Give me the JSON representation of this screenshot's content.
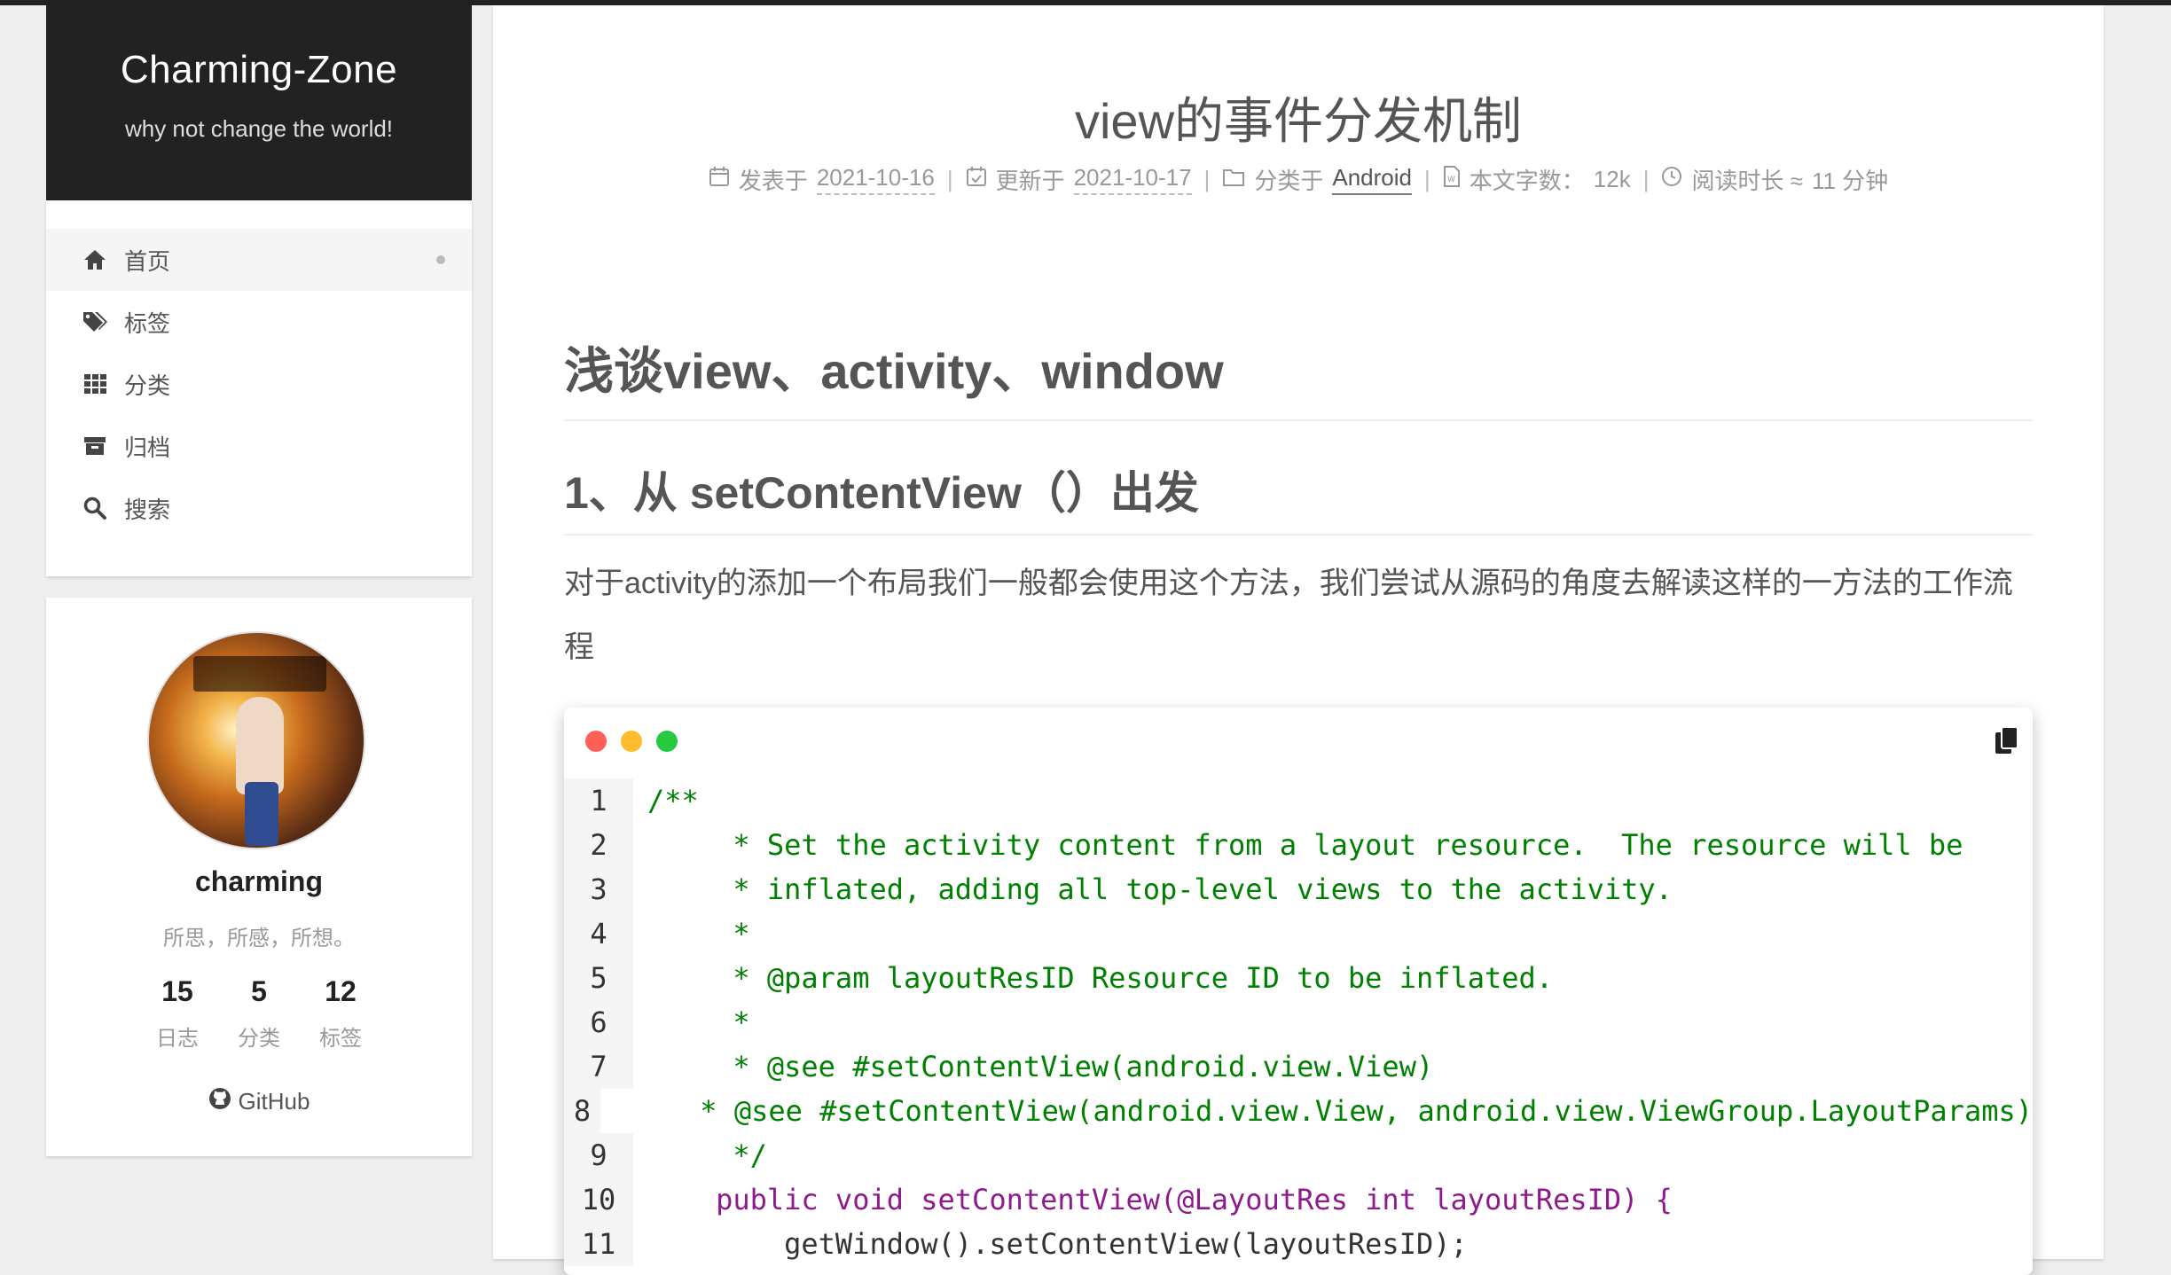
{
  "site": {
    "title": "Charming-Zone",
    "subtitle": "why not change the world!"
  },
  "menu": {
    "items": [
      {
        "label": "首页",
        "icon": "home-icon",
        "active": true
      },
      {
        "label": "标签",
        "icon": "tags-icon"
      },
      {
        "label": "分类",
        "icon": "grid-icon"
      },
      {
        "label": "归档",
        "icon": "archive-icon"
      },
      {
        "label": "搜索",
        "icon": "search-icon"
      }
    ]
  },
  "profile": {
    "name": "charming",
    "description": "所思，所感，所想。",
    "stats": [
      {
        "num": "15",
        "label": "日志"
      },
      {
        "num": "5",
        "label": "分类"
      },
      {
        "num": "12",
        "label": "标签"
      }
    ],
    "github": "GitHub"
  },
  "post": {
    "title": "view的事件分发机制",
    "meta": {
      "posted_label": "发表于",
      "posted_date": "2021-10-16",
      "updated_label": "更新于",
      "updated_date": "2021-10-17",
      "category_label": "分类于",
      "category": "Android",
      "words_label": "本文字数：",
      "words": "12k",
      "read_label": "阅读时长 ≈",
      "read_time": "11 分钟"
    },
    "heading1": "浅谈view、activity、window",
    "heading2": "1、从 setContentView（）出发",
    "paragraph": "对于activity的添加一个布局我们一般都会使用这个方法，我们尝试从源码的角度去解读这样的一方法的工作流程"
  },
  "code": {
    "window_colors": [
      "#ff5f56",
      "#ffbd2e",
      "#27c93f"
    ],
    "lines": [
      {
        "num": "1",
        "text": "/**"
      },
      {
        "num": "2",
        "text": "     * Set the activity content from a layout resource.  The resource will be"
      },
      {
        "num": "3",
        "text": "     * inflated, adding all top-level views to the activity."
      },
      {
        "num": "4",
        "text": "     *"
      },
      {
        "num": "5",
        "text": "     * @param layoutResID Resource ID to be inflated."
      },
      {
        "num": "6",
        "text": "     *"
      },
      {
        "num": "7",
        "text": "     * @see #setContentView(android.view.View)"
      },
      {
        "num": "8",
        "text": "     * @see #setContentView(android.view.View, android.view.ViewGroup.LayoutParams)"
      },
      {
        "num": "9",
        "text": "     */"
      },
      {
        "num": "10",
        "text": "    public void setContentView(@LayoutRes int layoutResID) {"
      },
      {
        "num": "11",
        "text": "        getWindow().setContentView(layoutResID);"
      }
    ]
  }
}
